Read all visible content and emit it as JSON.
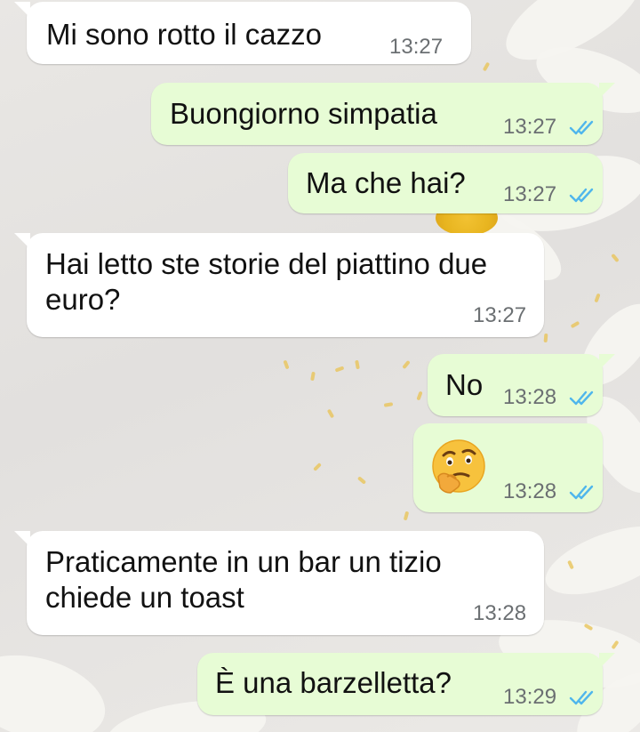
{
  "messages": [
    {
      "direction": "incoming",
      "text": "Mi sono rotto il cazzo",
      "time": "13:27"
    },
    {
      "direction": "outgoing",
      "text": "Buongiorno simpatia",
      "time": "13:27",
      "status": "read"
    },
    {
      "direction": "outgoing",
      "text": "Ma che hai?",
      "time": "13:27",
      "status": "read"
    },
    {
      "direction": "incoming",
      "text": "Hai letto ste storie del piattino due euro?",
      "time": "13:27"
    },
    {
      "direction": "outgoing",
      "text": "No",
      "time": "13:28",
      "status": "read"
    },
    {
      "direction": "outgoing",
      "text": "",
      "emoji": "thinking-face",
      "time": "13:28",
      "status": "read"
    },
    {
      "direction": "incoming",
      "text": "Praticamente in un bar un tizio chiede un toast",
      "time": "13:28"
    },
    {
      "direction": "outgoing",
      "text": "È una barzelletta?",
      "time": "13:29",
      "status": "read"
    }
  ],
  "colors": {
    "incoming_bubble": "#ffffff",
    "outgoing_bubble": "#e7fcd5",
    "read_ticks": "#4fb6ec",
    "timestamp": "#6b6f72"
  }
}
